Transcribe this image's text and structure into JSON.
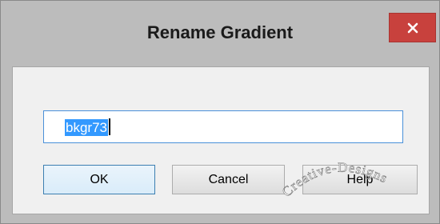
{
  "dialog": {
    "title": "Rename Gradient",
    "name_value": "bkgr73",
    "ok_label": "OK",
    "cancel_label": "Cancel",
    "help_label": "Help",
    "close_glyph": "×",
    "close_color": "#c8413d"
  },
  "watermark": {
    "text": "Creative-Designs"
  }
}
